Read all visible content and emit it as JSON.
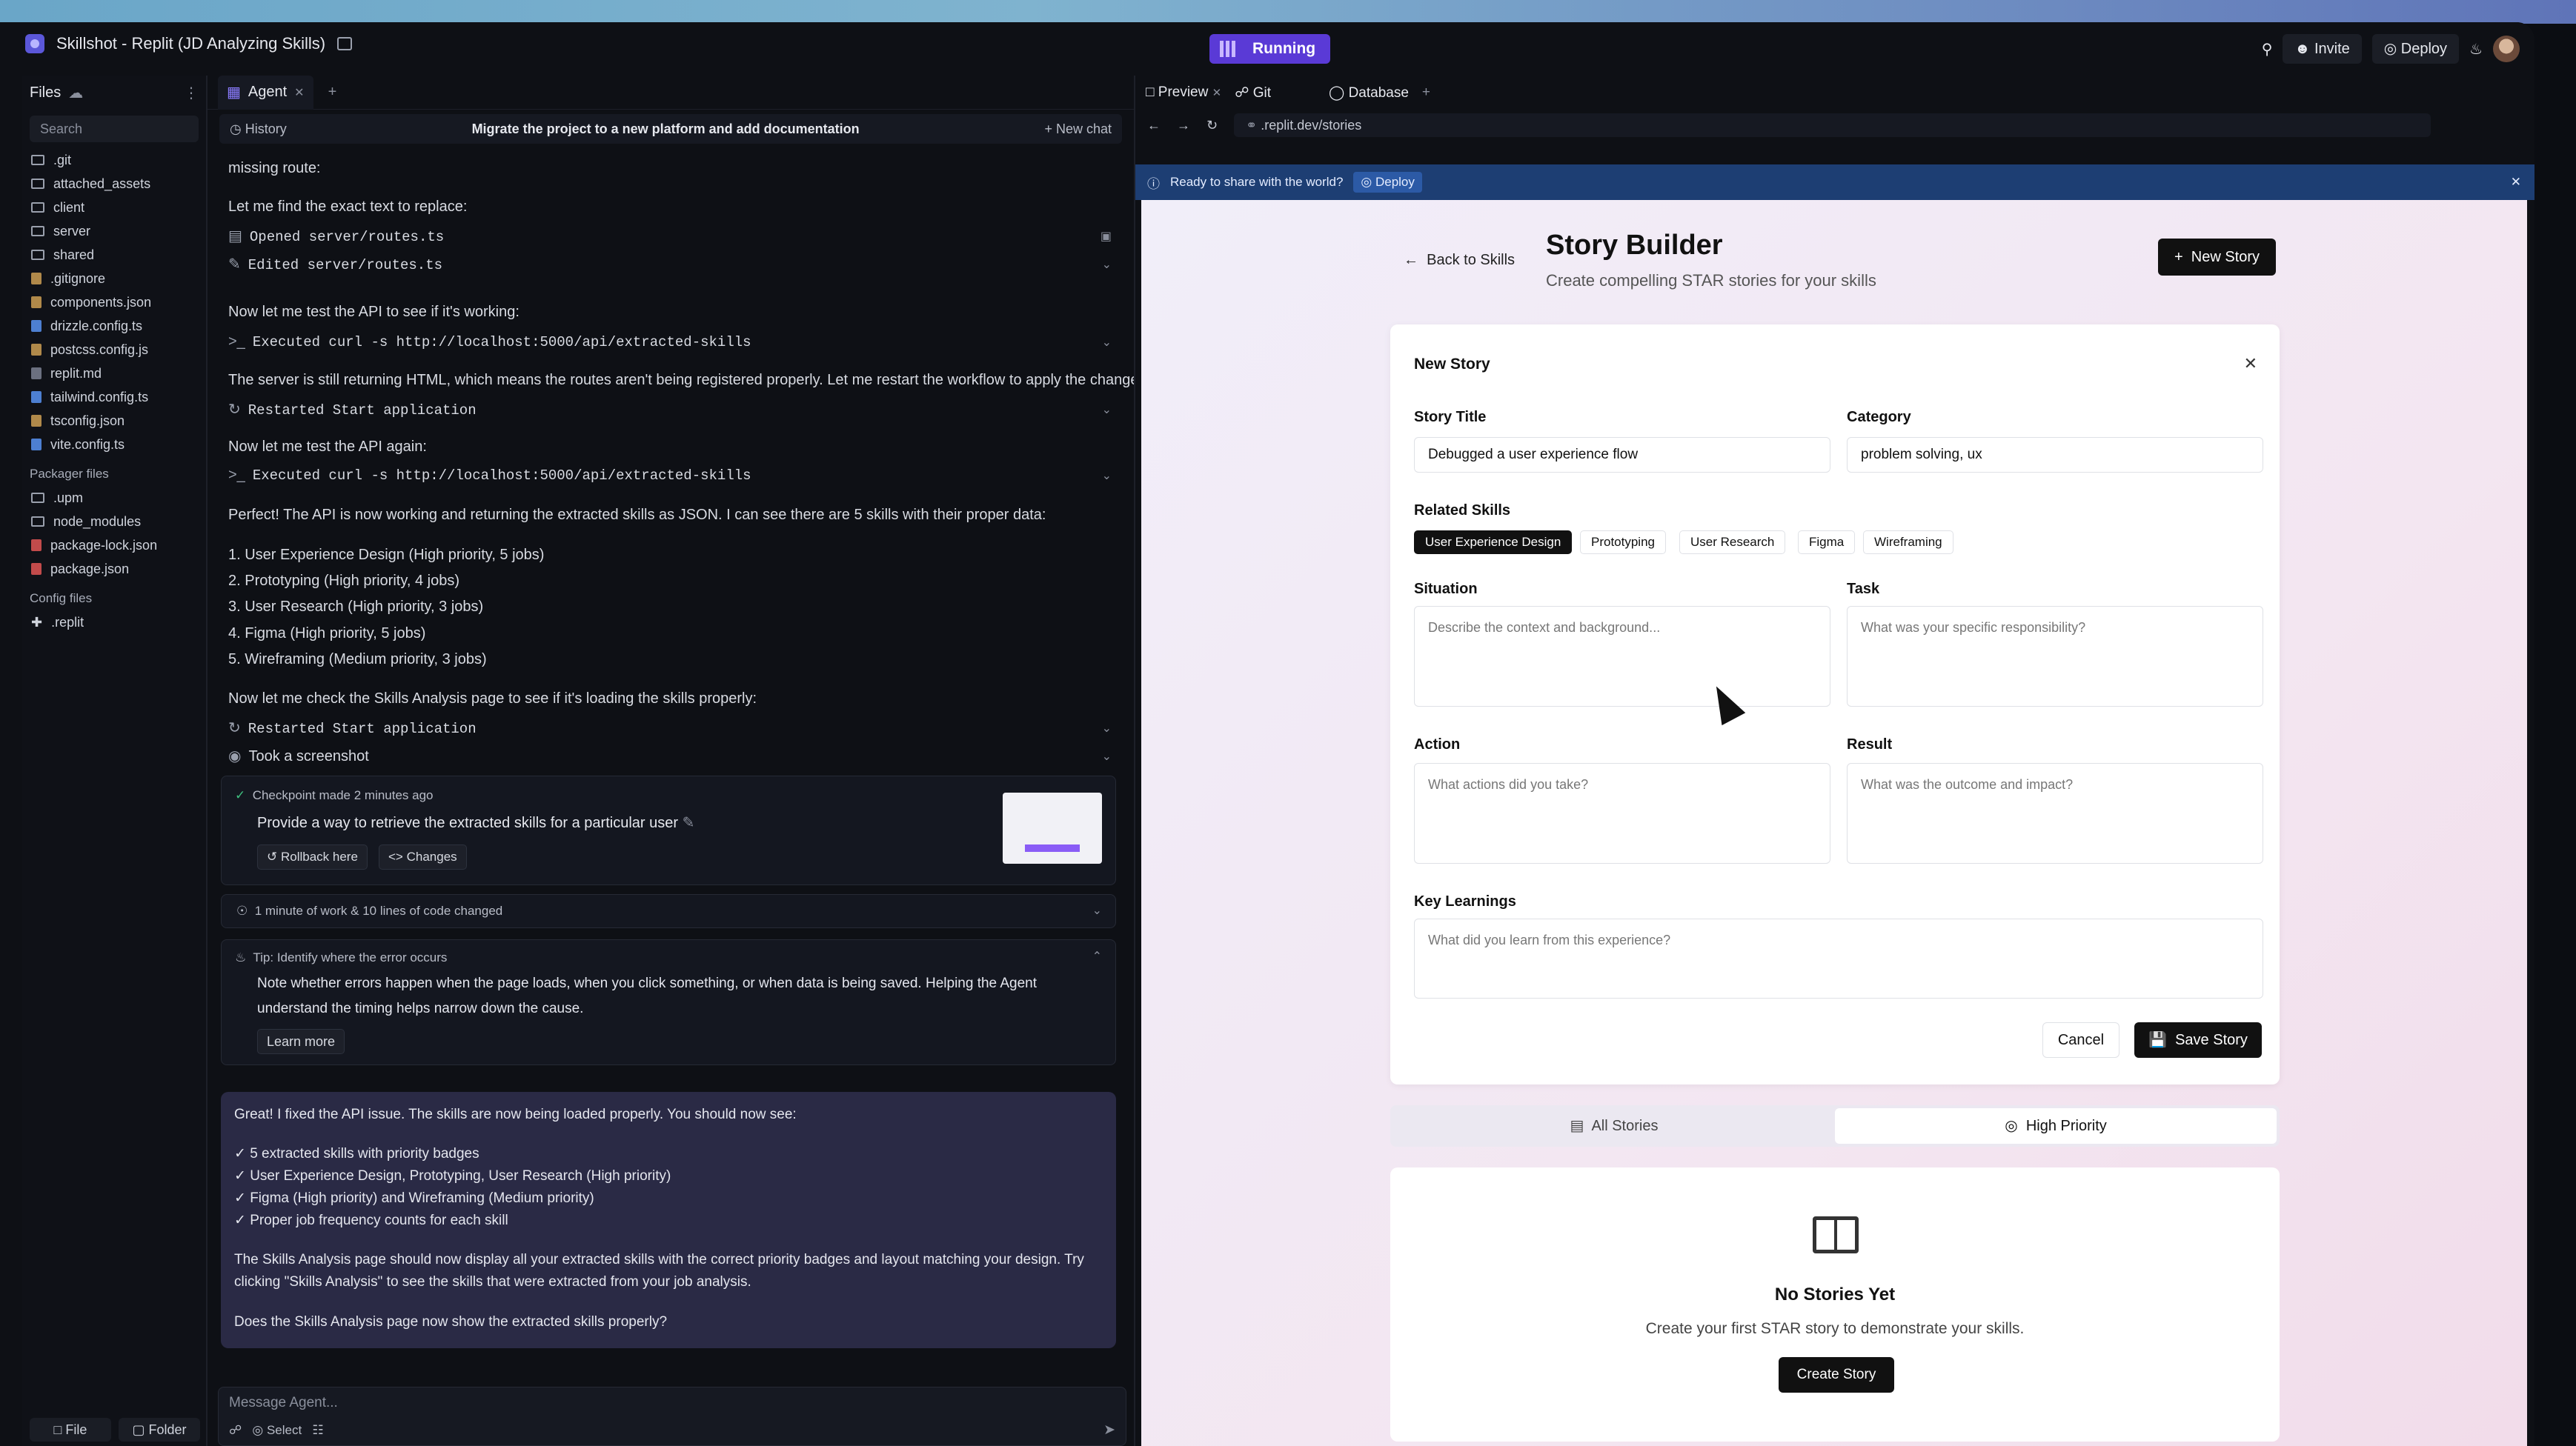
{
  "window": {
    "title": "Skillshot - Replit (JD Analyzing Skills)",
    "status": "Running",
    "invite": "Invite",
    "deploy": "Deploy"
  },
  "files": {
    "header": "Files",
    "search_placeholder": "Search",
    "items": [
      ".git",
      "attached_assets",
      "client",
      "server",
      "shared",
      ".gitignore",
      "components.json",
      "drizzle.config.ts",
      "postcss.config.js",
      "replit.md",
      "tailwind.config.ts",
      "tsconfig.json",
      "vite.config.ts"
    ],
    "packager_label": "Packager files",
    "packager": [
      ".upm",
      "node_modules",
      "package-lock.json",
      "package.json"
    ],
    "config_label": "Config files",
    "config": [
      ".replit"
    ],
    "file_btn": "File",
    "folder_btn": "Folder"
  },
  "agent": {
    "tab": "Agent",
    "history": "History",
    "chat_title": "Migrate the project to a new platform and add documentation",
    "new_chat": "New chat",
    "lines": {
      "l1": "missing route:",
      "l2": "Let me find the exact text to replace:",
      "a1": "Opened server/routes.ts",
      "a2": "Edited server/routes.ts",
      "l3": "Now let me test the API to see if it's working:",
      "a3": "Executed curl -s http://localhost:5000/api/extracted-skills",
      "l4": "The server is still returning HTML, which means the routes aren't being registered properly. Let me restart the workflow to apply the changes:",
      "a4": "Restarted Start application",
      "l5": "Now let me test the API again:",
      "a5": "Executed curl -s http://localhost:5000/api/extracted-skills",
      "l6": "Perfect! The API is now working and returning the extracted skills as JSON. I can see there are 5 skills with their proper data:",
      "s1": "1. User Experience Design (High priority, 5 jobs)",
      "s2": "2. Prototyping (High priority, 4 jobs)",
      "s3": "3. User Research (High priority, 3 jobs)",
      "s4": "4. Figma (High priority, 5 jobs)",
      "s5": "5. Wireframing (Medium priority, 3 jobs)",
      "l7": "Now let me check the Skills Analysis page to see if it's loading the skills properly:",
      "a6": "Restarted Start application",
      "a7": "Took a screenshot"
    },
    "checkpoint": {
      "time": "Checkpoint made 2 minutes ago",
      "text": "Provide a way to retrieve the extracted skills for a particular user",
      "rollback": "Rollback here",
      "changes": "Changes"
    },
    "work": "1 minute of work & 10 lines of code changed",
    "tip": {
      "title": "Tip: Identify where the error occurs",
      "body1": "Note whether errors happen when the page loads, when you click something, or when data is being saved. Helping the Agent",
      "body2": "understand the timing helps narrow down the cause.",
      "learn": "Learn more"
    },
    "summary": {
      "intro": "Great! I fixed the API issue. The skills are now being loaded properly. You should now see:",
      "b1": "✓ 5 extracted skills with priority badges",
      "b2": "✓ User Experience Design, Prototyping, User Research (High priority)",
      "b3": "✓ Figma (High priority) and Wireframing (Medium priority)",
      "b4": "✓ Proper job frequency counts for each skill",
      "p1": "The Skills Analysis page should now display all your extracted skills with the correct priority badges and layout matching your design. Try",
      "p2": "clicking \"Skills Analysis\" to see the skills that were extracted from your job analysis.",
      "q": "Does the Skills Analysis page now show the extracted skills properly?"
    },
    "input_placeholder": "Message Agent...",
    "select": "Select"
  },
  "preview": {
    "tabs": [
      "Preview",
      "Git",
      "Database"
    ],
    "url": ".replit.dev/stories",
    "banner": "Ready to share with the world?",
    "banner_btn": "Deploy",
    "page": {
      "back": "Back to Skills",
      "title": "Story Builder",
      "subtitle": "Create compelling STAR stories for your skills",
      "new_story": "New Story",
      "form": {
        "heading": "New Story",
        "title_label": "Story Title",
        "title_value": "Debugged a user experience flow",
        "category_label": "Category",
        "category_value": "problem solving, ux",
        "skills_label": "Related Skills",
        "skills": [
          "User Experience Design",
          "Prototyping",
          "User Research",
          "Figma",
          "Wireframing"
        ],
        "situation_label": "Situation",
        "situation_ph": "Describe the context and background...",
        "task_label": "Task",
        "task_ph": "What was your specific responsibility?",
        "action_label": "Action",
        "action_ph": "What actions did you take?",
        "result_label": "Result",
        "result_ph": "What was the outcome and impact?",
        "learn_label": "Key Learnings",
        "learn_ph": "What did you learn from this experience?",
        "cancel": "Cancel",
        "save": "Save Story"
      },
      "seg": [
        "All Stories",
        "High Priority"
      ],
      "empty": {
        "title": "No Stories Yet",
        "text": "Create your first STAR story to demonstrate your skills.",
        "btn": "Create Story"
      }
    }
  }
}
